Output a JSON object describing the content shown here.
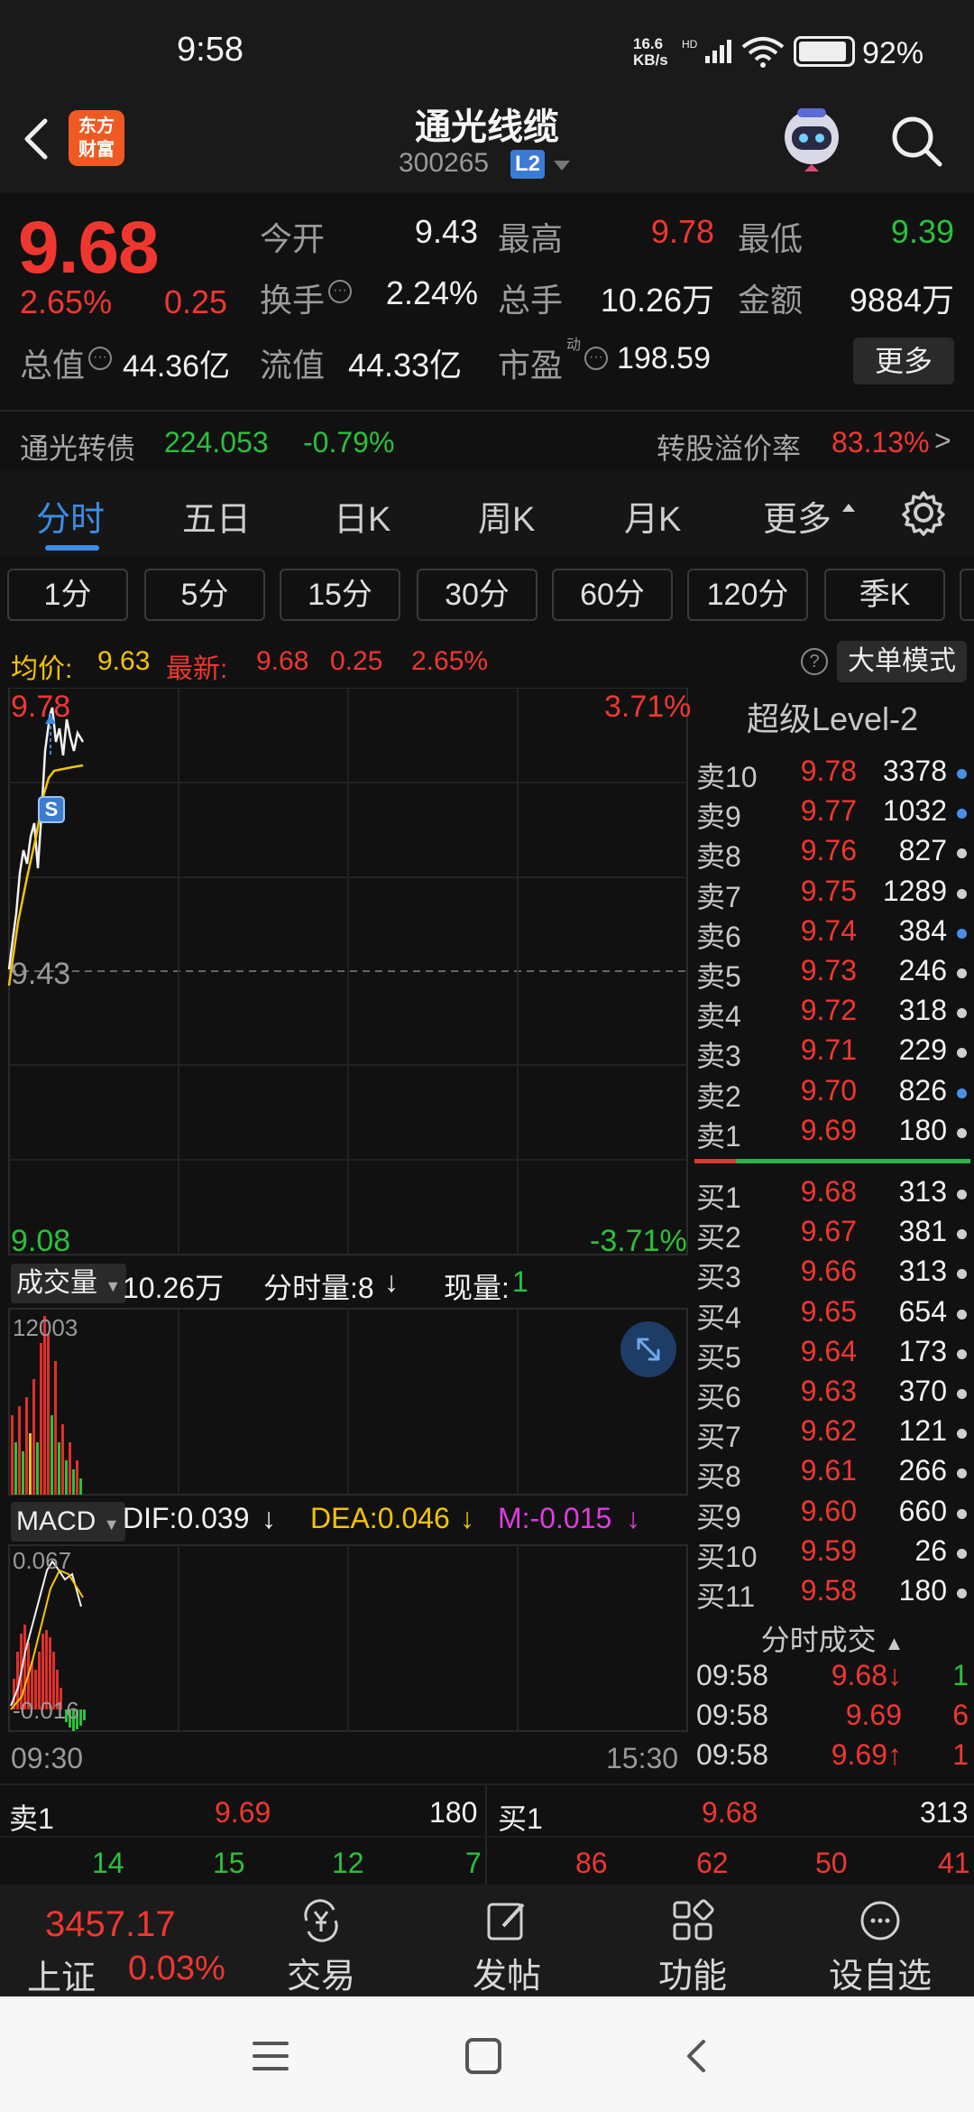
{
  "status": {
    "time": "9:58",
    "net_speed": "16.6",
    "net_unit": "KB/s",
    "net_tag": "HD",
    "battery": "92%"
  },
  "header": {
    "title": "通光线缆",
    "code": "300265",
    "level_badge": "L2",
    "logo_line1": "东方",
    "logo_line2": "财富"
  },
  "quote": {
    "price": "9.68",
    "change_pct": "2.65%",
    "change": "0.25",
    "rows": [
      [
        {
          "label": "今开",
          "value": "9.43",
          "color": "white"
        },
        {
          "label": "最高",
          "value": "9.78",
          "color": "red"
        },
        {
          "label": "最低",
          "value": "9.39",
          "color": "green"
        }
      ],
      [
        {
          "label": "换手",
          "value": "2.24%",
          "color": "white"
        },
        {
          "label": "总手",
          "value": "10.26万",
          "color": "white"
        },
        {
          "label": "金额",
          "value": "9884万",
          "color": "white"
        }
      ]
    ],
    "total_mv_label": "总值",
    "total_mv": "44.36亿",
    "float_mv_label": "流值",
    "float_mv": "44.33亿",
    "pe_label": "市盈",
    "pe_sup": "动",
    "pe": "198.59",
    "more": "更多",
    "cb_name": "通光转债",
    "cb_price": "224.053",
    "cb_pct": "-0.79%",
    "cb_premium_label": "转股溢价率",
    "cb_premium": "83.13%"
  },
  "tabs": [
    "分时",
    "五日",
    "日K",
    "周K",
    "月K",
    "更多"
  ],
  "periods": [
    "1分",
    "5分",
    "15分",
    "30分",
    "60分",
    "120分",
    "季K"
  ],
  "infoline": {
    "avg_label": "均价:",
    "avg": "9.63",
    "last_label": "最新:",
    "last": "9.68",
    "chg": "0.25",
    "pct": "2.65%",
    "big_order_mode": "大单模式",
    "help": "?"
  },
  "main_chart": {
    "top_price": "9.78",
    "top_pct": "3.71%",
    "mid_price": "9.43",
    "bottom_price": "9.08",
    "bottom_pct": "-3.71%",
    "marker": "S"
  },
  "volume": {
    "selector": "成交量",
    "total": "10.26万",
    "minute_label": "分时量:8",
    "current_label": "现量:",
    "current": "1",
    "max_label": "12003"
  },
  "macd": {
    "selector": "MACD",
    "dif": "DIF:0.039",
    "dea": "DEA:0.046",
    "m": "M:-0.015",
    "top": "0.067",
    "bottom": "-0.016"
  },
  "time_axis": {
    "start": "09:30",
    "end": "15:30"
  },
  "level2": {
    "title": "超级Level-2",
    "asks": [
      {
        "label": "卖10",
        "price": "9.78",
        "vol": "3378",
        "dot": "blue"
      },
      {
        "label": "卖9",
        "price": "9.77",
        "vol": "1032",
        "dot": "blue"
      },
      {
        "label": "卖8",
        "price": "9.76",
        "vol": "827",
        "dot": "gray"
      },
      {
        "label": "卖7",
        "price": "9.75",
        "vol": "1289",
        "dot": "gray"
      },
      {
        "label": "卖6",
        "price": "9.74",
        "vol": "384",
        "dot": "blue"
      },
      {
        "label": "卖5",
        "price": "9.73",
        "vol": "246",
        "dot": "gray"
      },
      {
        "label": "卖4",
        "price": "9.72",
        "vol": "318",
        "dot": "gray"
      },
      {
        "label": "卖3",
        "price": "9.71",
        "vol": "229",
        "dot": "gray"
      },
      {
        "label": "卖2",
        "price": "9.70",
        "vol": "826",
        "dot": "blue"
      },
      {
        "label": "卖1",
        "price": "9.69",
        "vol": "180",
        "dot": "gray"
      }
    ],
    "bids": [
      {
        "label": "买1",
        "price": "9.68",
        "vol": "313",
        "dot": "gray"
      },
      {
        "label": "买2",
        "price": "9.67",
        "vol": "381",
        "dot": "gray"
      },
      {
        "label": "买3",
        "price": "9.66",
        "vol": "313",
        "dot": "gray"
      },
      {
        "label": "买4",
        "price": "9.65",
        "vol": "654",
        "dot": "gray"
      },
      {
        "label": "买5",
        "price": "9.64",
        "vol": "173",
        "dot": "gray"
      },
      {
        "label": "买6",
        "price": "9.63",
        "vol": "370",
        "dot": "gray"
      },
      {
        "label": "买7",
        "price": "9.62",
        "vol": "121",
        "dot": "gray"
      },
      {
        "label": "买8",
        "price": "9.61",
        "vol": "266",
        "dot": "gray"
      },
      {
        "label": "买9",
        "price": "9.60",
        "vol": "660",
        "dot": "gray"
      },
      {
        "label": "买10",
        "price": "9.59",
        "vol": "26",
        "dot": "gray"
      },
      {
        "label": "买11",
        "price": "9.58",
        "vol": "180",
        "dot": "gray"
      }
    ],
    "ticks_title": "分时成交",
    "ticks": [
      {
        "time": "09:58",
        "price": "9.68↓",
        "vol": "1",
        "pcolor": "red",
        "vcolor": "green"
      },
      {
        "time": "09:58",
        "price": "9.69",
        "vol": "6",
        "pcolor": "red",
        "vcolor": "red"
      },
      {
        "time": "09:58",
        "price": "9.69↑",
        "vol": "1",
        "pcolor": "red",
        "vcolor": "red"
      }
    ]
  },
  "bidask": {
    "ask_label": "卖1",
    "ask_price": "9.69",
    "ask_vol": "180",
    "bid_label": "买1",
    "bid_price": "9.68",
    "bid_vol": "313",
    "left_nums": [
      "14",
      "15",
      "12",
      "7"
    ],
    "right_nums": [
      "86",
      "62",
      "50",
      "41"
    ]
  },
  "bottomnav": {
    "index_value": "3457.17",
    "index_name": "上证",
    "index_pct": "0.03%",
    "items": [
      "交易",
      "发帖",
      "功能",
      "设自选"
    ]
  },
  "colors": {
    "up": "#f0372f",
    "down": "#2bc13a",
    "accent": "#3b8ce8",
    "avg_line": "#f5c400",
    "bg": "#111111"
  }
}
